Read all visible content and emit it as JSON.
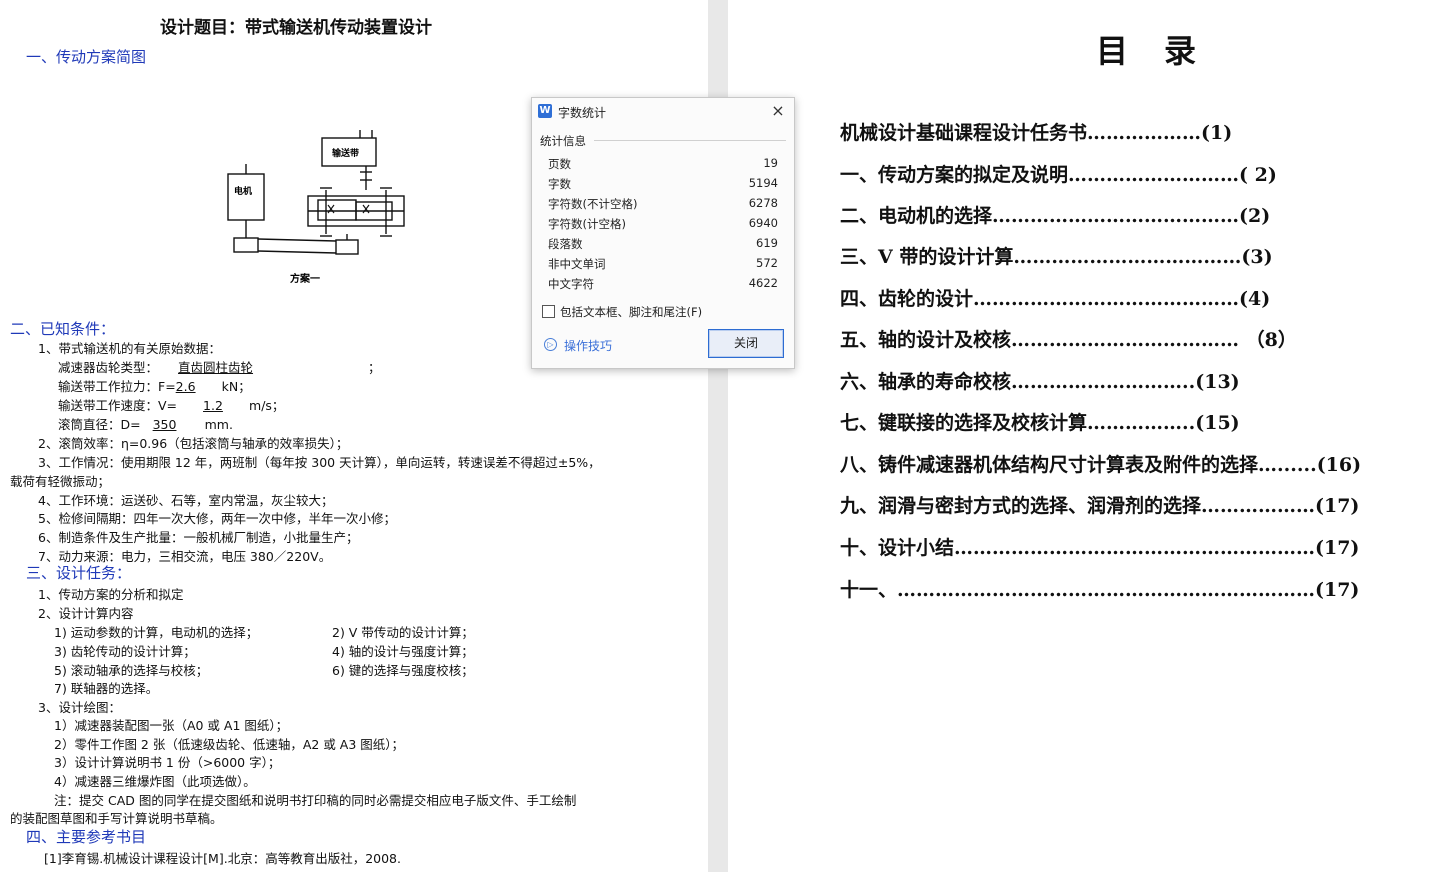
{
  "left_page": {
    "title": "设计题目：带式输送机传动装置设计",
    "section1_heading": "一、传动方案简图",
    "diagram": {
      "conveyor_label": "输送带",
      "motor_label": "电机",
      "caption": "方案一"
    },
    "section2_heading": "二、已知条件：",
    "conditions": {
      "item1": "1、带式输送机的有关原始数据：",
      "reducer_label": "减速器齿轮类型：",
      "reducer_value": "直齿圆柱齿轮",
      "force_label": "输送带工作拉力：F=",
      "force_value": "2.6",
      "force_unit": "kN；",
      "speed_label": "输送带工作速度：V=",
      "speed_value": "1.2",
      "speed_unit": "m/s；",
      "drum_label": "滚筒直径：D=",
      "drum_value": "350",
      "drum_unit": "mm.",
      "item2": "2、滚筒效率：η=0.96（包括滚筒与轴承的效率损失）；",
      "item3a": "3、工作情况：使用期限 12 年，两班制（每年按 300 天计算），单向运转，转速误差不得超过±5%，",
      "item3b": "载荷有轻微振动；",
      "item4": "4、工作环境：运送砂、石等，室内常温，灰尘较大；",
      "item5": "5、检修间隔期：四年一次大修，两年一次中修，半年一次小修；",
      "item6": "6、制造条件及生产批量：一般机械厂制造，小批量生产；",
      "item7": "7、动力来源：电力，三相交流，电压 380／220V。"
    },
    "section3_heading": "三、设计任务：",
    "tasks": {
      "t1": "1、传动方案的分析和拟定",
      "t2": "2、设计计算内容",
      "c1": "1) 运动参数的计算，电动机的选择；",
      "c2": "2) V 带传动的设计计算；",
      "c3": "3) 齿轮传动的设计计算；",
      "c4": "4) 轴的设计与强度计算；",
      "c5": "5) 滚动轴承的选择与校核；",
      "c6": "6) 键的选择与强度校核；",
      "c7": "7) 联轴器的选择。",
      "t3": "3、设计绘图：",
      "d1": "1）减速器装配图一张（A0 或 A1 图纸）；",
      "d2": "2）零件工作图 2 张（低速级齿轮、低速轴，A2 或 A3 图纸）；",
      "d3": "3）设计计算说明书 1 份（>6000 字）；",
      "d4": "4）减速器三维爆炸图（此项选做）。",
      "note1": "注：提交 CAD 图的同学在提交图纸和说明书打印稿的同时必需提交相应电子版文件、手工绘制",
      "note2": "的装配图草图和手写计算说明书草稿。"
    },
    "section4_heading": "四、主要参考书目",
    "refs": {
      "r1": "[1]李育锡.机械设计课程设计[M].北京：高等教育出版社，2008."
    }
  },
  "right_page": {
    "toc_title": "目录",
    "toc_items": [
      "机械设计基础课程设计任务书………………(1)",
      "一、传动方案的拟定及说明………………………( 2)",
      "二、电动机的选择…………………………………(2)",
      "三、V 带的设计计算………………………………(3)",
      "四、齿轮的设计……………………………………(4)",
      "五、轴的设计及校核……………………………… （8）",
      "六、轴承的寿命校核………………………..(13)",
      "七、键联接的选择及校核计算……………..(15)",
      "八、铸件减速器机体结构尺寸计算表及附件的选择…......(16)",
      "九、润滑与密封方式的选择、润滑剂的选择………………(17)",
      "十、设计小结…………………………………………………(17)",
      "十一、…………………………………………………………(17)"
    ]
  },
  "dialog": {
    "app_icon": "W",
    "title": "字数统计",
    "section": "统计信息",
    "stats": [
      {
        "label": "页数",
        "value": "19"
      },
      {
        "label": "字数",
        "value": "5194"
      },
      {
        "label": "字符数(不计空格)",
        "value": "6278"
      },
      {
        "label": "字符数(计空格)",
        "value": "6940"
      },
      {
        "label": "段落数",
        "value": "619"
      },
      {
        "label": "非中文单词",
        "value": "572"
      },
      {
        "label": "中文字符",
        "value": "4622"
      }
    ],
    "checkbox_label": "包括文本框、脚注和尾注(F)",
    "checkbox_checked": false,
    "tips_label": "操作技巧",
    "close_button": "关闭",
    "close_icon": "×"
  }
}
